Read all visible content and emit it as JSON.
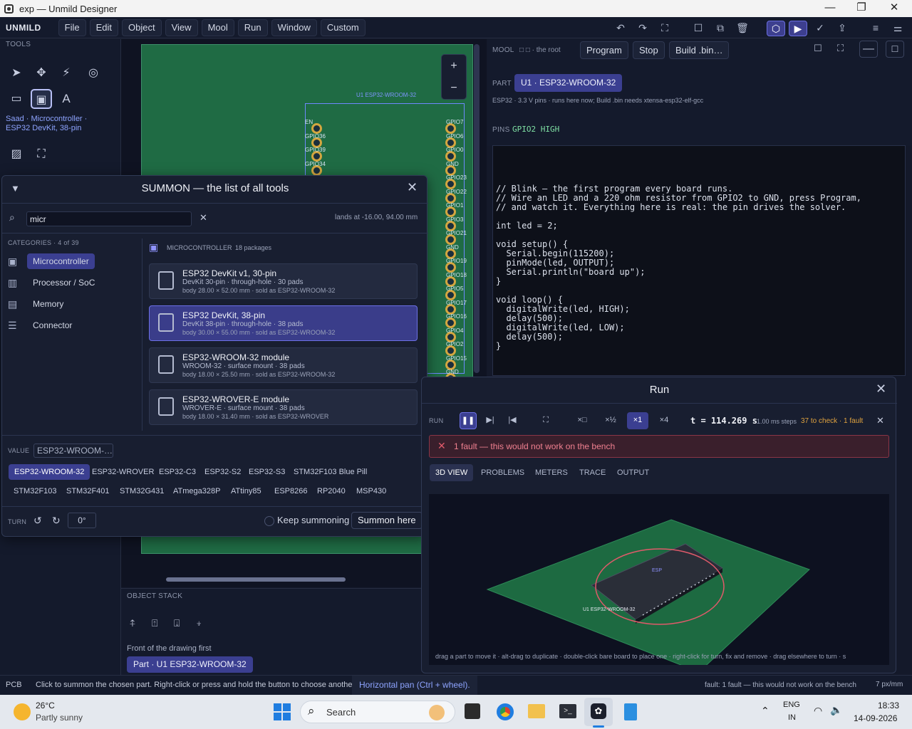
{
  "window": {
    "title": "exp — Unmild Designer"
  },
  "menubar": {
    "brand": "UNMILD",
    "menus": [
      "File",
      "Edit",
      "Object",
      "View",
      "Mool",
      "Run",
      "Window",
      "Custom"
    ]
  },
  "tools": {
    "label": "TOOLS",
    "active_part": "Saad · Microcontroller · ESP32 DevKit, 38-pin"
  },
  "board": {
    "module_label": "U1 ESP32-WROOM-32",
    "left_pins": [
      "EN",
      "GPIO36",
      "GPIO39",
      "GPIO34"
    ],
    "right_pins": [
      "GPIO7",
      "GPIO6",
      "GPIO0",
      "GND",
      "GPIO23",
      "GPIO22",
      "GPIO1",
      "GPIO3",
      "GPIO21",
      "GND",
      "GPIO19",
      "GPIO18",
      "GPIO5",
      "GPIO17",
      "GPIO16",
      "GPIO4",
      "GPIO2",
      "GPIO15",
      "GND"
    ]
  },
  "object_stack": {
    "label": "OBJECT STACK",
    "hint": "Front of the drawing first",
    "item": "Part · U1 ESP32-WROOM-32"
  },
  "mool": {
    "label": "MOOL",
    "root": "□ □ · the root",
    "program": "Program",
    "stop": "Stop",
    "build": "Build .bin…",
    "part_label": "PART",
    "part_name": "U1 · ESP32-WROOM-32",
    "part_desc": "ESP32 · 3.3 V pins · runs here now; Build .bin needs xtensa-esp32-elf-gcc",
    "pins_label": "PINS",
    "pins_value": "GPIO2 HIGH"
  },
  "code": "// Blink — the first program every board runs.\n// Wire an LED and a 220 ohm resistor from GPIO2 to GND, press Program,\n// and watch it. Everything here is real: the pin drives the solver.\n\nint led = 2;\n\nvoid setup() {\n  Serial.begin(115200);\n  pinMode(led, OUTPUT);\n  Serial.println(\"board up\");\n}\n\nvoid loop() {\n  digitalWrite(led, HIGH);\n  delay(500);\n  digitalWrite(led, LOW);\n  delay(500);\n}",
  "summon": {
    "title": "SUMMON — the list of all tools",
    "search_value": "micr",
    "lands_at": "lands at -16.00, 94.00 mm",
    "categories_label": "CATEGORIES · 4 of 39",
    "categories": [
      "Microcontroller",
      "Processor / SoC",
      "Memory",
      "Connector"
    ],
    "section_title": "MICROCONTROLLER",
    "section_count": "18 packages",
    "packages": [
      {
        "name": "ESP32 DevKit v1, 30-pin",
        "detail": "DevKit 30-pin · through-hole · 30 pads",
        "body": "body 28.00 × 52.00 mm · sold as ESP32-WROOM-32"
      },
      {
        "name": "ESP32 DevKit, 38-pin",
        "detail": "DevKit 38-pin · through-hole · 38 pads",
        "body": "body 30.00 × 55.00 mm · sold as ESP32-WROOM-32"
      },
      {
        "name": "ESP32-WROOM-32 module",
        "detail": "WROOM-32 · surface mount · 38 pads",
        "body": "body 18.00 × 25.50 mm · sold as ESP32-WROOM-32"
      },
      {
        "name": "ESP32-WROVER-E module",
        "detail": "WROVER-E · surface mount · 38 pads",
        "body": "body 18.00 × 31.40 mm · sold as ESP32-WROVER"
      }
    ],
    "value_label": "VALUE",
    "value": "ESP32-WROOM-…",
    "chips_row1": [
      "ESP32-WROOM-32",
      "ESP32-WROVER",
      "ESP32-C3",
      "ESP32-S2",
      "ESP32-S3",
      "STM32F103 Blue Pill"
    ],
    "chips_row2": [
      "STM32F103",
      "STM32F401",
      "STM32G431",
      "ATmega328P",
      "ATtiny85",
      "ESP8266",
      "RP2040",
      "MSP430"
    ],
    "turn_label": "TURN",
    "turn_value": "0°",
    "keep": "Keep summoning",
    "summon_here": "Summon here"
  },
  "run": {
    "title": "Run",
    "run_label": "RUN",
    "speeds": [
      "×□",
      "×½",
      "×1",
      "×4"
    ],
    "time": "t = 114.269 s",
    "steps": "1.00 ms steps",
    "check": "37 to check · 1 fault",
    "fault": "1 fault — this would not work on the bench",
    "tabs": [
      "3D VIEW",
      "PROBLEMS",
      "METERS",
      "TRACE",
      "OUTPUT"
    ],
    "part_label": "U1 ESP32-WROOM-32",
    "chip_text": "ESP",
    "hint": "drag a part to move it · alt-drag to duplicate · double-click bare board to place one · right-click for turn, fix and remove · drag elsewhere to turn · s"
  },
  "status": {
    "mode": "PCB",
    "message": "Click to summon the chosen part. Right-click or press and hold the button to choose another.",
    "hint": "Horizontal pan (Ctrl + wheel).",
    "fault": "fault: 1 fault — this would not work on the bench",
    "scale": "7 px/mm"
  },
  "taskbar": {
    "temp": "26°C",
    "weather": "Partly sunny",
    "search": "Search",
    "lang1": "ENG",
    "lang2": "IN",
    "time": "18:33",
    "date": "14-09-2026"
  },
  "colors": {
    "accent": "#3b3f91",
    "board": "#1f6b44",
    "fault": "#e05a6a",
    "pad": "#d3a640"
  }
}
